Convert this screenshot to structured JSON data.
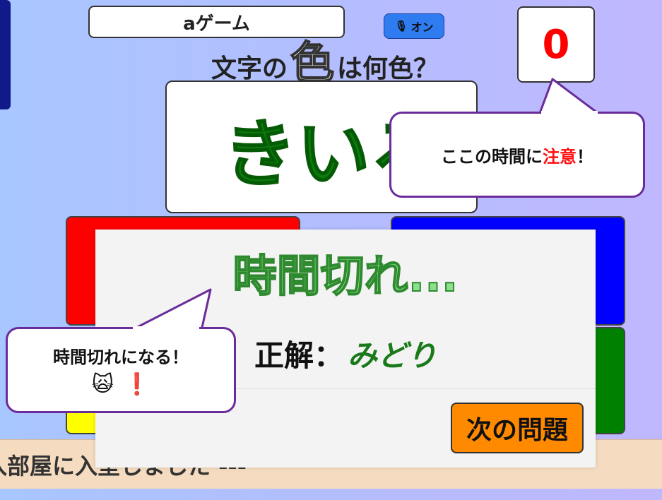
{
  "header": {
    "game_title": "aゲーム",
    "voice_label": "オン",
    "voice_icon": "microphone-icon",
    "score": "0"
  },
  "question": {
    "prefix": "文字の",
    "emphasis": "色",
    "suffix": "は何色？"
  },
  "word_card": {
    "text": "きいろ",
    "text_color": "#0c7a0c"
  },
  "answer_buttons": [
    {
      "color_name": "red",
      "color": "#ff0000"
    },
    {
      "color_name": "blue",
      "color": "#0000ff"
    },
    {
      "color_name": "yellow",
      "color": "#ffff00"
    },
    {
      "color_name": "green",
      "color": "#008000"
    }
  ],
  "chat": {
    "message": "入部屋に入室しました ---"
  },
  "timeout_panel": {
    "title": "時間切れ...",
    "answer_label": "正解：",
    "answer_value": "みどり",
    "next_button": "次の問題"
  },
  "callouts": {
    "timer_tip_prefix": "ここの時間に",
    "timer_tip_warn": "注意",
    "timer_tip_suffix": "！",
    "timeout_tip": "時間切れになる！",
    "cat_emoji": "🙀",
    "exclamation": "❗"
  },
  "colors": {
    "accent_purple": "#6a2c9a",
    "next_button_orange": "#ff8a00",
    "score_red": "#ff0000"
  }
}
